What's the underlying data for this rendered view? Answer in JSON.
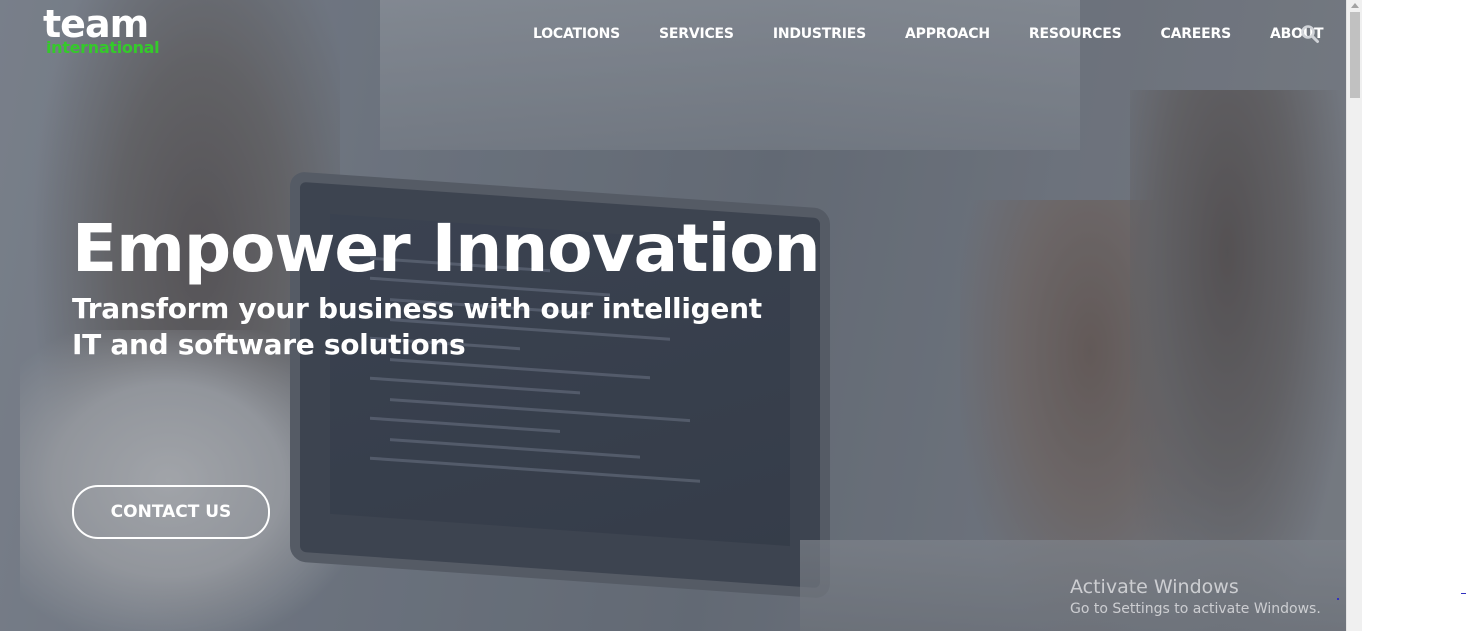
{
  "logo": {
    "line1": "team",
    "line2": "international"
  },
  "nav": {
    "items": [
      "LOCATIONS",
      "SERVICES",
      "INDUSTRIES",
      "APPROACH",
      "RESOURCES",
      "CAREERS",
      "ABOUT"
    ],
    "search_icon": "search-icon"
  },
  "hero": {
    "title": "Empower Innovation",
    "subtitle": "Transform your business with our intelligent IT and software solutions",
    "cta_label": "CONTACT US"
  },
  "watermark": {
    "title": "Activate Windows",
    "subtitle": "Go to Settings to activate Windows."
  },
  "colors": {
    "brand_green": "#35c92b",
    "text": "#ffffff"
  }
}
